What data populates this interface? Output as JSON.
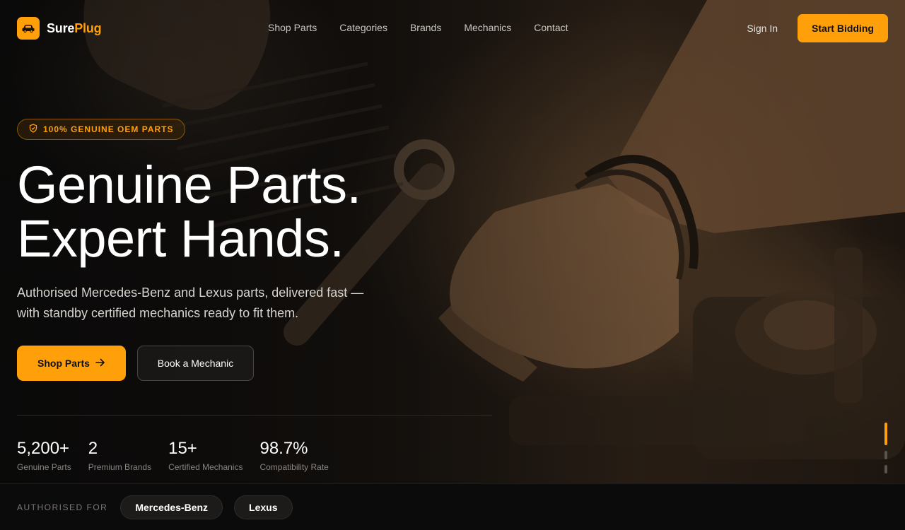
{
  "brand": {
    "name_part1": "Sure",
    "name_part2": "Plug",
    "accent": "#ff9f0a",
    "logo_icon": "car-icon"
  },
  "nav": {
    "items": [
      "Shop Parts",
      "Categories",
      "Brands",
      "Mechanics",
      "Contact"
    ]
  },
  "header": {
    "signin_label": "Sign In",
    "cta_label": "Start Bidding"
  },
  "hero": {
    "badge_icon": "shield-check-icon",
    "badge_text": "100% GENUINE OEM PARTS",
    "headline_line1": "Genuine Parts.",
    "headline_line2": "Expert Hands.",
    "subtitle_line1": "Authorised Mercedes-Benz and Lexus parts, delivered fast —",
    "subtitle_line2": "with standby certified mechanics ready to fit them.",
    "primary_cta": "Shop Parts",
    "primary_cta_icon": "arrow-right-icon",
    "secondary_cta": "Book a Mechanic"
  },
  "stats": [
    {
      "value": "5,200+",
      "label": "Genuine Parts"
    },
    {
      "value": "2",
      "label": "Premium Brands"
    },
    {
      "value": "15+",
      "label": "Certified Mechanics"
    },
    {
      "value": "98.7%",
      "label": "Compatibility Rate"
    }
  ],
  "slider": {
    "total_slides": 3,
    "active_slide": 1
  },
  "authorised": {
    "label": "AUTHORISED FOR",
    "brands": [
      "Mercedes-Benz",
      "Lexus"
    ]
  }
}
